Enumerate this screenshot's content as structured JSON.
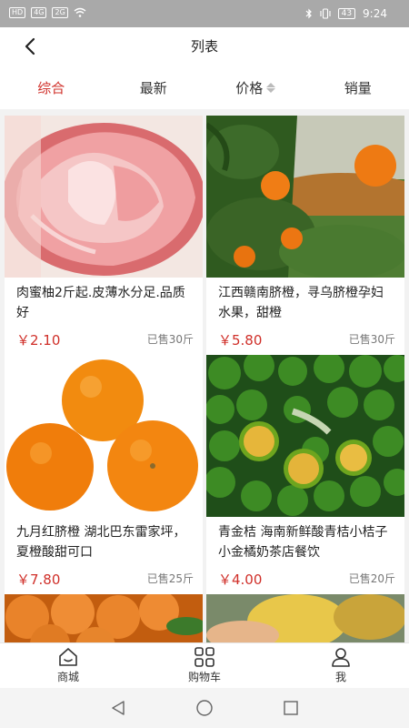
{
  "status": {
    "left_chips": [
      "HD",
      "4G",
      "2G"
    ],
    "battery": "43",
    "time": "9:24"
  },
  "header": {
    "title": "列表"
  },
  "sort": {
    "tabs": [
      {
        "label": "综合",
        "active": true
      },
      {
        "label": "最新",
        "active": false
      },
      {
        "label": "价格",
        "active": false
      },
      {
        "label": "销量",
        "active": false
      }
    ]
  },
  "products": [
    {
      "name": "肉蜜柚2斤起.皮薄水分足.品质好",
      "price": "￥2.10",
      "sold": "已售30斤",
      "image": "pomelo"
    },
    {
      "name": "江西赣南脐橙，寻乌脐橙孕妇水果，甜橙",
      "price": "￥5.80",
      "sold": "已售30斤",
      "image": "orange-tree"
    },
    {
      "name": "九月红脐橙 湖北巴东雷家坪，夏橙酸甜可口",
      "price": "￥7.80",
      "sold": "已售25斤",
      "image": "oranges"
    },
    {
      "name": "青金桔 海南新鲜酸青桔小桔子小金橘奶茶店餐饮",
      "price": "￥4.00",
      "sold": "已售20斤",
      "image": "green-kumquat"
    },
    {
      "name": "",
      "price": "",
      "sold": "",
      "image": "mandarins"
    },
    {
      "name": "",
      "price": "",
      "sold": "",
      "image": "lemons"
    }
  ],
  "tabbar": {
    "items": [
      {
        "label": "商城",
        "icon": "home-icon"
      },
      {
        "label": "购物车",
        "icon": "grid-icon"
      },
      {
        "label": "我",
        "icon": "user-icon"
      }
    ]
  },
  "colors": {
    "accent": "#d0302a",
    "price": "#d0302a"
  }
}
